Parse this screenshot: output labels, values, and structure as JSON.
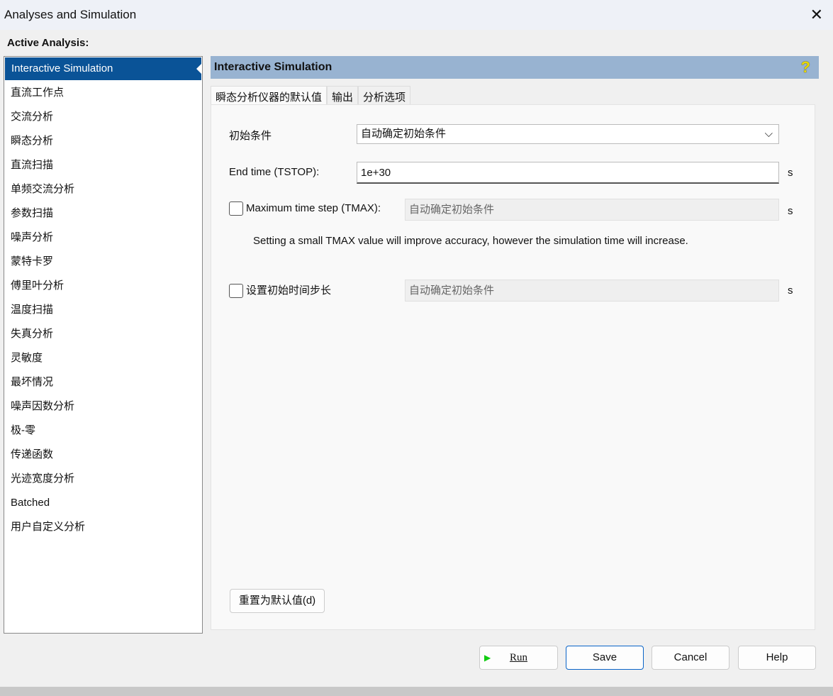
{
  "window": {
    "title": "Analyses and Simulation"
  },
  "active_analysis_label": "Active Analysis:",
  "analyses": [
    "Interactive Simulation",
    "直流工作点",
    "交流分析",
    "瞬态分析",
    "直流扫描",
    "单频交流分析",
    "参数扫描",
    "噪声分析",
    "蒙特卡罗",
    "傅里叶分析",
    "温度扫描",
    "失真分析",
    "灵敏度",
    "最坏情况",
    "噪声因数分析",
    "极-零",
    "传递函数",
    "光迹宽度分析",
    "Batched",
    "用户自定义分析"
  ],
  "header": {
    "title": "Interactive Simulation"
  },
  "tabs": [
    "瞬态分析仪器的默认值",
    "输出",
    "分析选项"
  ],
  "form": {
    "initial_label": "初始条件",
    "initial_value": "自动确定初始条件",
    "tstop_label": "End time (TSTOP):",
    "tstop_value": "1e+30",
    "unit": "s",
    "tmax_label": "Maximum time step (TMAX):",
    "tmax_value": "自动确定初始条件",
    "note": "Setting a small TMAX value will improve accuracy, however the simulation time will increase.",
    "init_step_label": "设置初始时间步长",
    "init_step_value": "自动确定初始条件",
    "reset_label": "重置为默认值(d)"
  },
  "buttons": {
    "run": "Run",
    "save": "Save",
    "cancel": "Cancel",
    "help": "Help"
  }
}
